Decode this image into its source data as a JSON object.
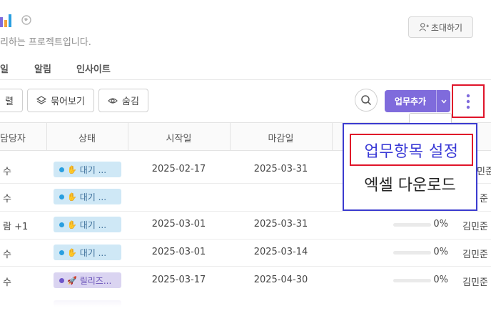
{
  "project": {
    "description": "리하는 프로젝트입니다.",
    "icons": [
      "bar-chart-icon",
      "globe-icon"
    ],
    "invite_label": "초대하기",
    "invite_icon": "add-user-icon"
  },
  "tabs": [
    "일",
    "알림",
    "인사이트"
  ],
  "toolbar": {
    "sort_label": "렬",
    "group_label": "묶어보기",
    "group_icon": "layers-icon",
    "hide_label": "숨김",
    "hide_icon": "eye-icon",
    "search_icon": "search-icon",
    "add_task_label": "업무추가",
    "add_task_caret_icon": "chevron-down-icon",
    "more_icon": "more-vertical-icon"
  },
  "table": {
    "headers": [
      "담당자",
      "상태",
      "시작일",
      "마감일"
    ],
    "rows": [
      {
        "assignee": "수",
        "status": "대기 ...",
        "status_type": "wait",
        "start": "2025-02-17",
        "due": "2025-03-31",
        "progress": "",
        "owner": "민준"
      },
      {
        "assignee": "수",
        "status": "대기 ...",
        "status_type": "wait",
        "start": "",
        "due": "",
        "progress": "",
        "owner": "준"
      },
      {
        "assignee": "람 +1",
        "status": "대기 ...",
        "status_type": "wait",
        "start": "2025-03-01",
        "due": "2025-03-31",
        "progress": "0%",
        "owner": "김민준"
      },
      {
        "assignee": "수",
        "status": "대기 ...",
        "status_type": "wait",
        "start": "2025-03-01",
        "due": "2025-03-14",
        "progress": "0%",
        "owner": "김민준"
      },
      {
        "assignee": "수",
        "status": "릴리즈...",
        "status_type": "release",
        "start": "2025-03-17",
        "due": "2025-04-30",
        "progress": "0%",
        "owner": "김민준"
      }
    ]
  },
  "menu": {
    "items": [
      "업무항목 설정",
      "엑셀 다운로드"
    ]
  },
  "colors": {
    "accent": "#7f6bdc",
    "highlight_red": "#e0142a",
    "highlight_blue": "#3b3bcf",
    "status_wait_bg": "#cfe8f6",
    "status_release_bg": "#dad4f1"
  }
}
